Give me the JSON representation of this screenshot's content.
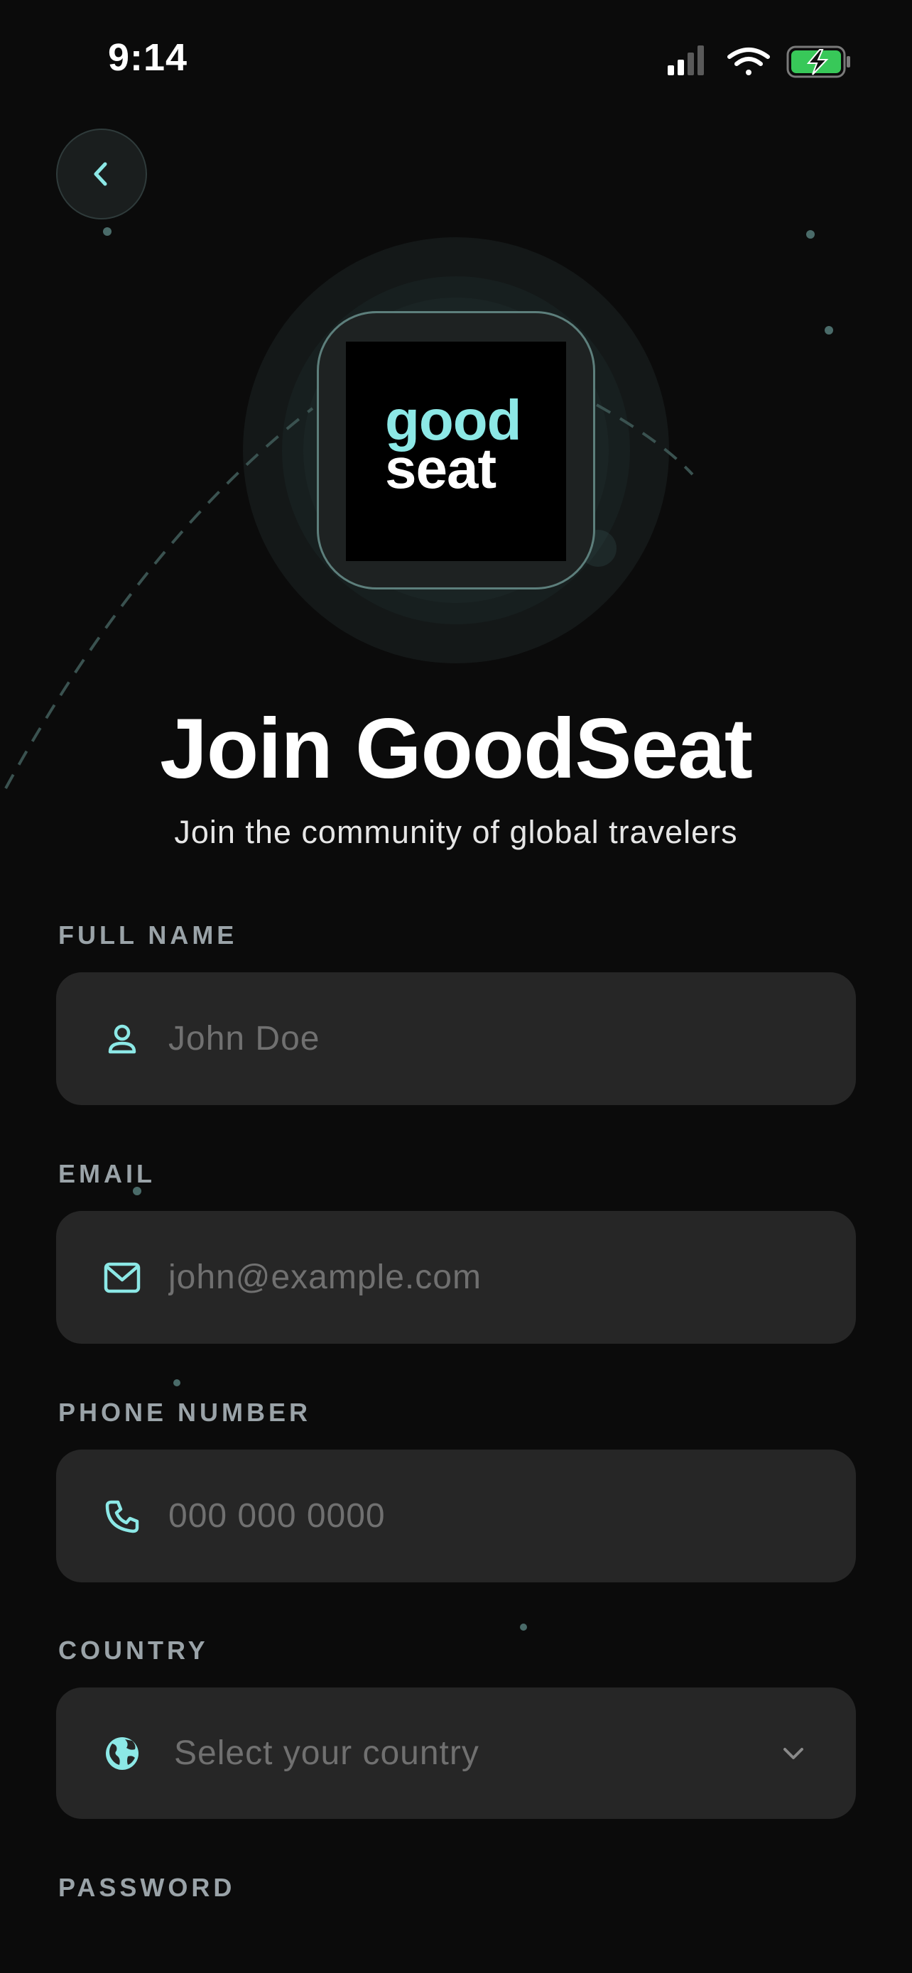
{
  "status_bar": {
    "time": "9:14"
  },
  "brand": {
    "logo_line1": "good",
    "logo_line2": "seat",
    "accent": "#8ce8e6"
  },
  "header": {
    "title": "Join GoodSeat",
    "subtitle": "Join the community of global travelers"
  },
  "form": {
    "full_name": {
      "label": "FULL NAME",
      "placeholder": "John Doe",
      "icon": "user-icon"
    },
    "email": {
      "label": "EMAIL",
      "placeholder": "john@example.com",
      "icon": "mail-icon"
    },
    "phone": {
      "label": "PHONE NUMBER",
      "placeholder": "000 000 0000",
      "icon": "phone-icon"
    },
    "country": {
      "label": "COUNTRY",
      "placeholder": "Select your country",
      "icon": "globe-icon"
    },
    "password": {
      "label": "PASSWORD"
    }
  },
  "colors": {
    "background": "#0b0b0b",
    "field_bg": "#262626",
    "accent": "#8ce8e6",
    "label": "#9aa3a8"
  }
}
